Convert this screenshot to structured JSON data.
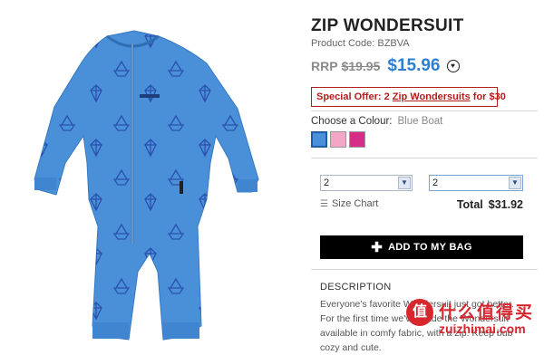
{
  "product": {
    "title": "ZIP WONDERSUIT",
    "code": "Product Code: BZBVA",
    "rrp_label": "RRP",
    "rrp_value": "$19.95",
    "price": "$15.96"
  },
  "offer": {
    "prefix": "Special Offer: 2 ",
    "link": "Zip Wondersuits",
    "suffix": " for $30"
  },
  "colour": {
    "label": "Choose a Colour:",
    "value": "Blue Boat",
    "swatches": [
      {
        "name": "blue",
        "color": "#4a90d9"
      },
      {
        "name": "pink",
        "color": "#f2a7c6"
      },
      {
        "name": "magenta",
        "color": "#d62d86"
      }
    ]
  },
  "selects": {
    "left_value": "2",
    "right_value": "2"
  },
  "size_chart_label": "Size Chart",
  "total": {
    "label": "Total",
    "value": "$31.92"
  },
  "add_button_label": "ADD TO MY BAG",
  "description": {
    "title": "DESCRIPTION",
    "text": "Everyone's favorite Wondersuit just got better. For the first time we've made the Wondersuit available in comfy fabric, with a zip. Keep bub cozy and cute."
  },
  "watermark": {
    "badge": "值",
    "cn": "什么值得买",
    "site": "zuizhimai.com"
  },
  "colors": {
    "suit": "#4a90d9",
    "price": "#2f7fd1",
    "offer": "#b21d1d"
  }
}
